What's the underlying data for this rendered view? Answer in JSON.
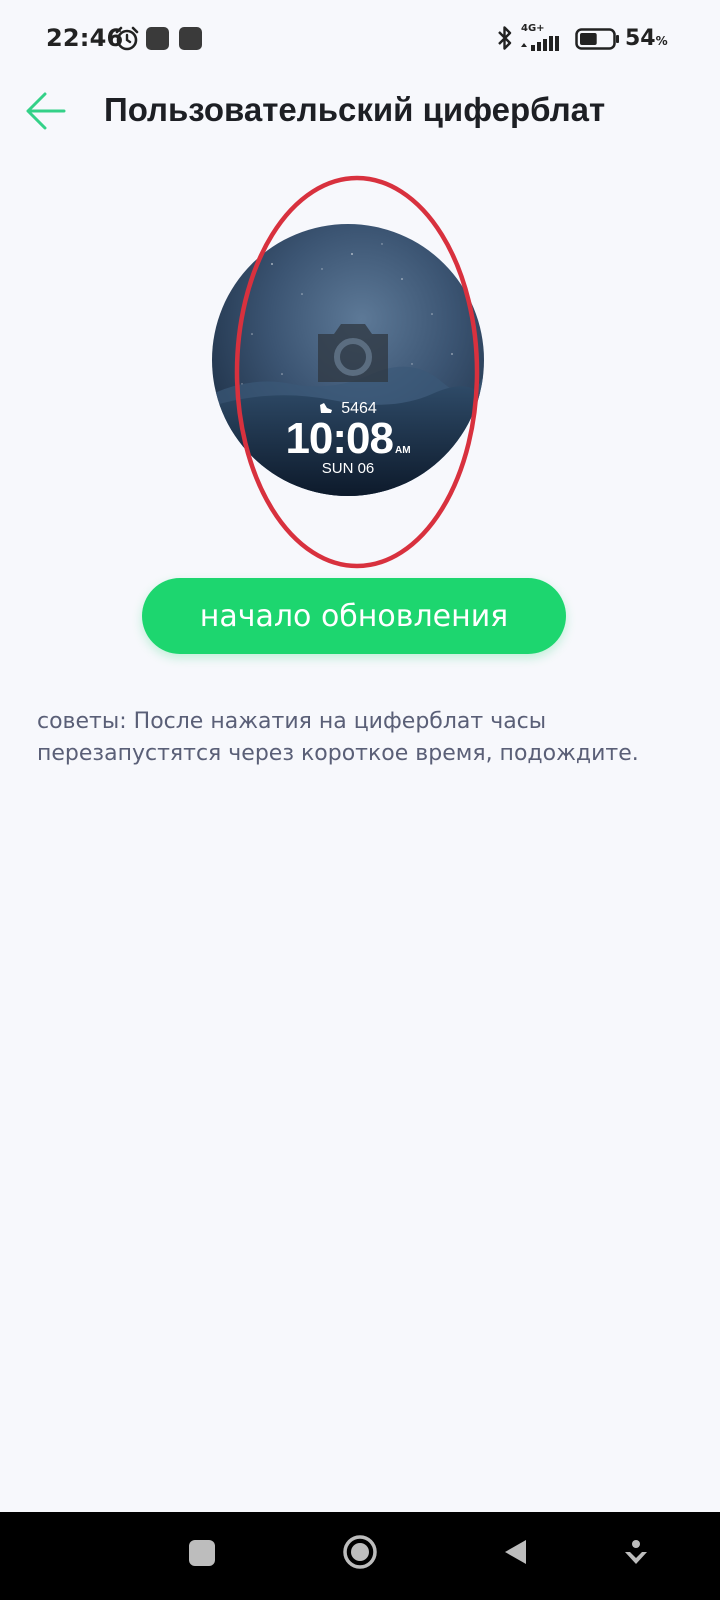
{
  "status_bar": {
    "time": "22:46",
    "network": "4G+",
    "battery_percent": "54",
    "battery_unit": "%",
    "battery_level": 0.54,
    "icons": [
      "alarm-icon",
      "app-notification-icon",
      "app-notification-icon",
      "bluetooth-icon",
      "signal-icon",
      "battery-icon"
    ]
  },
  "header": {
    "title": "Пользовательский циферблат",
    "back_icon": "arrow-left-icon",
    "accent_color": "#34d188"
  },
  "watch_face": {
    "steps": "5464",
    "time": "10:08",
    "ampm": "AM",
    "date": "SUN 06",
    "overlay_icon": "camera-icon",
    "highlight_color": "#d8313e"
  },
  "actions": {
    "start_button_label": "начало обновления",
    "button_color": "#1dd66f"
  },
  "tips": {
    "text": "советы: После нажатия на циферблат часы перезапустятся через короткое время, подождите."
  },
  "nav_bar": {
    "icons": [
      "recent-apps-icon",
      "home-icon",
      "back-icon",
      "assistant-icon"
    ]
  }
}
